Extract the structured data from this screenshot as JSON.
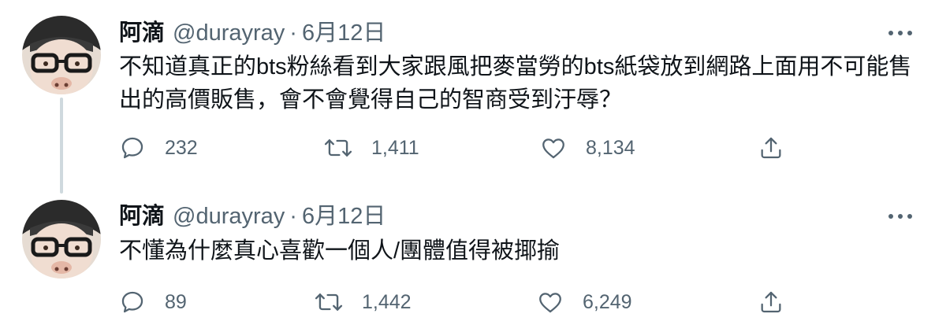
{
  "tweets": [
    {
      "author": {
        "name": "阿滴",
        "handle": "@durayray",
        "avatar_icon": "avatar-photo"
      },
      "separator": "·",
      "date": "6月12日",
      "text": "不知道真正的bts粉絲看到大家跟風把麥當勞的bts紙袋放到網路上面用不可能售出的高價販售，會不會覺得自己的智商受到汙辱？",
      "stats": {
        "replies": "232",
        "retweets": "1,411",
        "likes": "8,134"
      }
    },
    {
      "author": {
        "name": "阿滴",
        "handle": "@durayray",
        "avatar_icon": "avatar-photo"
      },
      "separator": "·",
      "date": "6月12日",
      "text": "不懂為什麼真心喜歡一個人/團體值得被揶揄",
      "stats": {
        "replies": "89",
        "retweets": "1,442",
        "likes": "6,249"
      }
    }
  ],
  "icons": {
    "more": "more-horizontal-icon",
    "reply": "reply-bubble-icon",
    "retweet": "retweet-arrows-icon",
    "like": "heart-icon",
    "share": "share-upload-icon"
  },
  "colors": {
    "primary_text": "#0f1419",
    "secondary_text": "#536471",
    "thread_line": "#cfd9de"
  }
}
